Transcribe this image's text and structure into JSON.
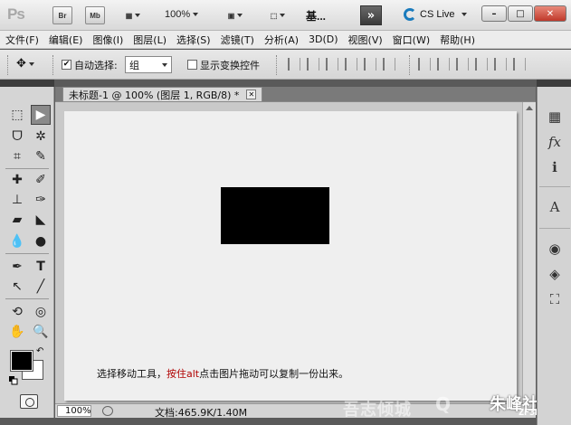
{
  "appbar": {
    "logo": "Ps",
    "bridge": "Br",
    "minibridge": "Mb",
    "zoom": "100%",
    "workspace": "基...",
    "more": "»",
    "cs_live": "CS Live",
    "minimize": "–",
    "restore": "□",
    "close": "✕"
  },
  "menu": [
    "文件(F)",
    "编辑(E)",
    "图像(I)",
    "图层(L)",
    "选择(S)",
    "滤镜(T)",
    "分析(A)",
    "3D(D)",
    "视图(V)",
    "窗口(W)",
    "帮助(H)"
  ],
  "options": {
    "auto_select_label": "自动选择:",
    "auto_select_checked": true,
    "auto_select_value": "组",
    "show_transform_label": "显示变换控件",
    "show_transform_checked": false
  },
  "document": {
    "tab_title": "未标题-1 @ 100% (图层 1, RGB/8) *",
    "tab_close": "✕",
    "caption_prefix": "选择移动工具，",
    "caption_red": "按住alt",
    "caption_suffix": "点击图片拖动可以复制一份出来。",
    "zoom": "100%",
    "doc_info": "文档:465.9K/1.40M"
  },
  "watermark": {
    "text1": "吾志倾城",
    "text2": "Q",
    "text3": "朱峰社区",
    "url": "ZF3D.COM"
  },
  "colors": {
    "foreground": "#000000",
    "background": "#ffffff"
  }
}
